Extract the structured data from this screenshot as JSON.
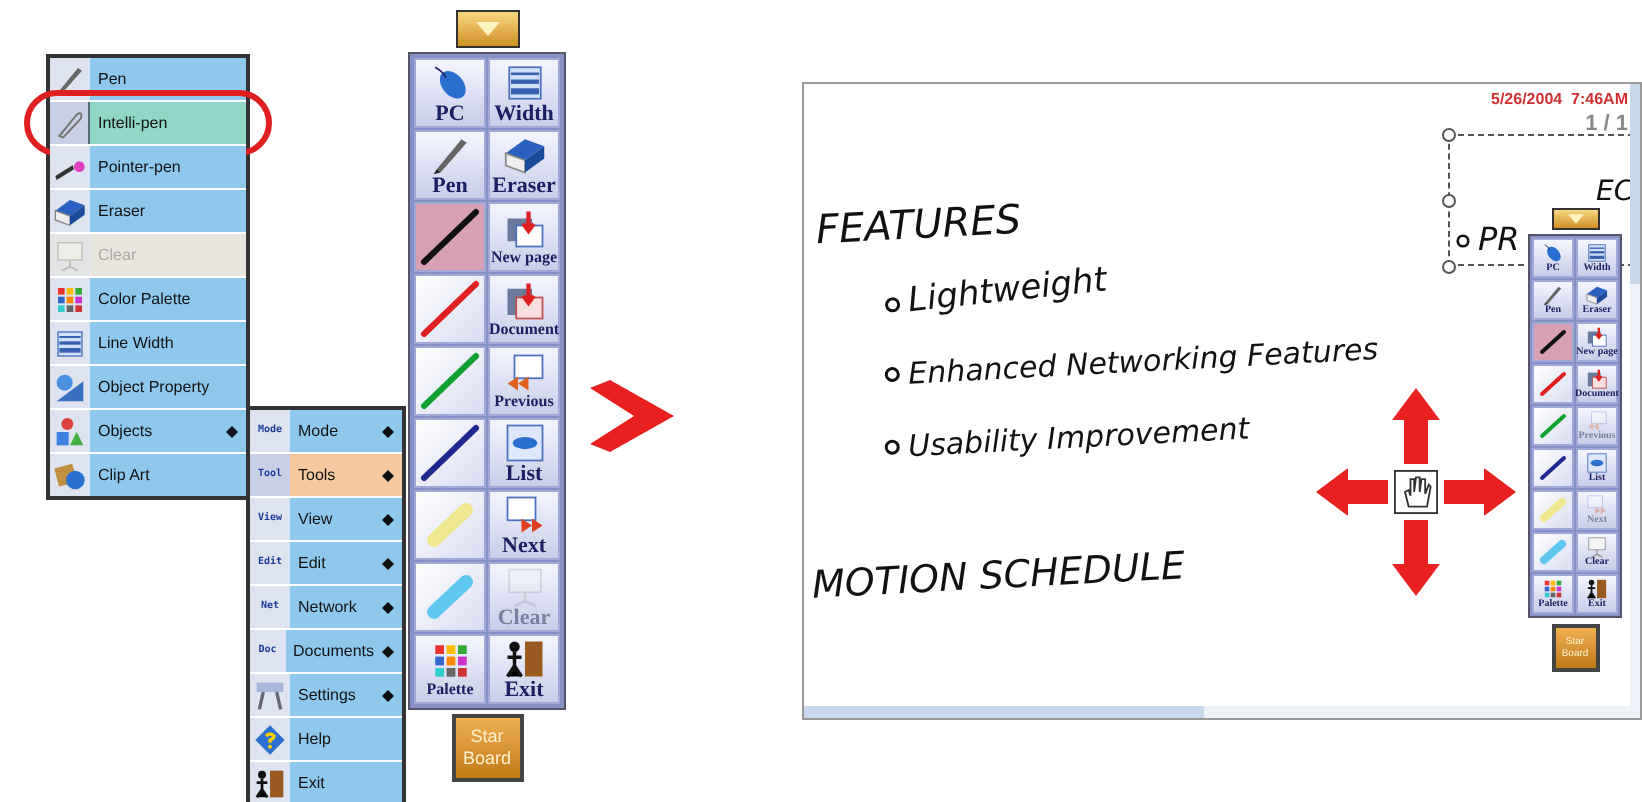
{
  "menu": {
    "items": [
      {
        "label": "Pen",
        "selected": false,
        "disabled": false,
        "has_submenu": false
      },
      {
        "label": "Intelli-pen",
        "selected": true,
        "disabled": false,
        "has_submenu": false
      },
      {
        "label": "Pointer-pen",
        "selected": false,
        "disabled": false,
        "has_submenu": false
      },
      {
        "label": "Eraser",
        "selected": false,
        "disabled": false,
        "has_submenu": false
      },
      {
        "label": "Clear",
        "selected": false,
        "disabled": true,
        "has_submenu": false
      },
      {
        "label": "Color Palette",
        "selected": false,
        "disabled": false,
        "has_submenu": false
      },
      {
        "label": "Line Width",
        "selected": false,
        "disabled": false,
        "has_submenu": false
      },
      {
        "label": "Object Property",
        "selected": false,
        "disabled": false,
        "has_submenu": false
      },
      {
        "label": "Objects",
        "selected": false,
        "disabled": false,
        "has_submenu": true
      },
      {
        "label": "Clip Art",
        "selected": false,
        "disabled": false,
        "has_submenu": false
      }
    ]
  },
  "submenu": {
    "items": [
      {
        "label": "Mode",
        "badge": "Mode",
        "selected": false,
        "has_submenu": true
      },
      {
        "label": "Tools",
        "badge": "Tool",
        "selected": true,
        "has_submenu": true
      },
      {
        "label": "View",
        "badge": "View",
        "selected": false,
        "has_submenu": true
      },
      {
        "label": "Edit",
        "badge": "Edit",
        "selected": false,
        "has_submenu": true
      },
      {
        "label": "Network",
        "badge": "Net",
        "selected": false,
        "has_submenu": true
      },
      {
        "label": "Documents",
        "badge": "Doc",
        "selected": false,
        "has_submenu": true
      },
      {
        "label": "Settings",
        "selected": false,
        "has_submenu": true
      },
      {
        "label": "Help",
        "selected": false,
        "has_submenu": false
      },
      {
        "label": "Exit",
        "selected": false,
        "has_submenu": false
      }
    ]
  },
  "toolbar": {
    "buttons": [
      {
        "kind": "tool",
        "label": "PC",
        "disabled": false
      },
      {
        "kind": "tool",
        "label": "Width",
        "disabled": false
      },
      {
        "kind": "tool",
        "label": "Pen",
        "disabled": false
      },
      {
        "kind": "tool",
        "label": "Eraser",
        "disabled": false
      },
      {
        "kind": "pen",
        "color": "#111111",
        "selected": true
      },
      {
        "kind": "tool",
        "label": "New page",
        "disabled": false
      },
      {
        "kind": "pen",
        "color": "#e02020",
        "selected": false
      },
      {
        "kind": "tool",
        "label": "Document",
        "disabled": false
      },
      {
        "kind": "pen",
        "color": "#10a030",
        "selected": false
      },
      {
        "kind": "tool",
        "label": "Previous",
        "disabled": false
      },
      {
        "kind": "pen",
        "color": "#202890",
        "selected": false
      },
      {
        "kind": "tool",
        "label": "List",
        "disabled": false
      },
      {
        "kind": "highlighter",
        "color": "#f0e890",
        "selected": false
      },
      {
        "kind": "tool",
        "label": "Next",
        "disabled": false
      },
      {
        "kind": "highlighter",
        "color": "#60c8f0",
        "selected": false
      },
      {
        "kind": "tool",
        "label": "Clear",
        "disabled": true
      },
      {
        "kind": "tool",
        "label": "Palette",
        "disabled": false
      },
      {
        "kind": "tool",
        "label": "Exit",
        "disabled": false
      }
    ],
    "star_board": "Star Board"
  },
  "screen": {
    "date": "5/26/2004  7:46AM",
    "page": "1 / 1",
    "notes": [
      {
        "kind": "heading",
        "text": "FEATURES"
      },
      {
        "kind": "bullet",
        "text": "Lightweight"
      },
      {
        "kind": "bullet",
        "text": "Enhanced Networking Features"
      },
      {
        "kind": "bullet",
        "text": "Usability Improvement"
      },
      {
        "kind": "heading",
        "text": "MOTION SCHEDULE"
      }
    ],
    "selected_text_1": "PR",
    "selected_text_2": "EC",
    "toolbar": {
      "buttons": [
        {
          "kind": "tool",
          "label": "PC",
          "disabled": false
        },
        {
          "kind": "tool",
          "label": "Width",
          "disabled": false
        },
        {
          "kind": "tool",
          "label": "Pen",
          "disabled": false
        },
        {
          "kind": "tool",
          "label": "Eraser",
          "disabled": false
        },
        {
          "kind": "pen",
          "color": "#111111",
          "selected": true
        },
        {
          "kind": "tool",
          "label": "New page",
          "disabled": false
        },
        {
          "kind": "pen",
          "color": "#e02020",
          "selected": false
        },
        {
          "kind": "tool",
          "label": "Document",
          "disabled": false
        },
        {
          "kind": "pen",
          "color": "#10a030",
          "selected": false
        },
        {
          "kind": "tool",
          "label": "Previous",
          "disabled": true
        },
        {
          "kind": "pen",
          "color": "#202890",
          "selected": false
        },
        {
          "kind": "tool",
          "label": "List",
          "disabled": false
        },
        {
          "kind": "highlighter",
          "color": "#f0e890",
          "selected": false
        },
        {
          "kind": "tool",
          "label": "Next",
          "disabled": true
        },
        {
          "kind": "highlighter",
          "color": "#60c8f0",
          "selected": false
        },
        {
          "kind": "tool",
          "label": "Clear",
          "disabled": false
        },
        {
          "kind": "tool",
          "label": "Palette",
          "disabled": false
        },
        {
          "kind": "tool",
          "label": "Exit",
          "disabled": false
        }
      ],
      "star_board": "Star Board"
    }
  }
}
